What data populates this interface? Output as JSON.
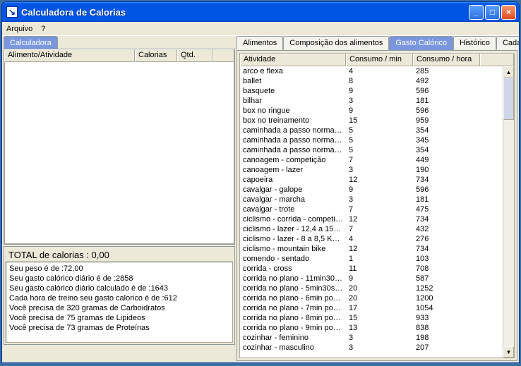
{
  "window": {
    "title": "Calculadora de Calorias"
  },
  "menu": {
    "file": "Arquivo",
    "help": "?"
  },
  "left": {
    "calc_tab": "Calculadora",
    "headers": {
      "alimento": "Alimento/Atividade",
      "calorias": "Calorias",
      "qtd": "Qtd."
    },
    "total_label": "TOTAL de calorias : 0,00",
    "lines": [
      "Seu peso é de :72,00",
      "Seu gasto calórico diário é de :2858",
      "Seu gasto calórico diário calculado é de :1643",
      "Cada hora de treino seu gasto calorico é de :612",
      "Você precisa de 320 gramas de Carboidratos",
      "Você precisa de  75 gramas de Lipideos",
      "Você precisa de  73 gramas de Proteínas"
    ]
  },
  "right": {
    "tabs": [
      "Alimentos",
      "Composição dos alimentos",
      "Gasto Calórico",
      "Histórico",
      "Cadastr"
    ],
    "active_tab": 2,
    "headers": {
      "atividade": "Atividade",
      "cmin": "Consumo / min",
      "chora": "Consumo / hora"
    },
    "rows": [
      {
        "a": "arco e flexa",
        "m": "4",
        "h": "285"
      },
      {
        "a": "ballet",
        "m": "8",
        "h": "492"
      },
      {
        "a": "basquete",
        "m": "9",
        "h": "596"
      },
      {
        "a": "bilhar",
        "m": "3",
        "h": "181"
      },
      {
        "a": "box no ringue",
        "m": "9",
        "h": "596"
      },
      {
        "a": "box no treinamento",
        "m": "15",
        "h": "959"
      },
      {
        "a": "caminhada a passo normal (...",
        "m": "5",
        "h": "354"
      },
      {
        "a": "caminhada a passo normal (...",
        "m": "5",
        "h": "345"
      },
      {
        "a": "caminhada a passo normal (...",
        "m": "5",
        "h": "354"
      },
      {
        "a": "canoagem - competição",
        "m": "7",
        "h": "449"
      },
      {
        "a": "canoagem - lazer",
        "m": "3",
        "h": "190"
      },
      {
        "a": "capoeira",
        "m": "12",
        "h": "734"
      },
      {
        "a": "cavalgar - galope",
        "m": "9",
        "h": "596"
      },
      {
        "a": "cavalgar - marcha",
        "m": "3",
        "h": "181"
      },
      {
        "a": "cavalgar - trote",
        "m": "7",
        "h": "475"
      },
      {
        "a": "ciclismo - corrida - competição",
        "m": "12",
        "h": "734"
      },
      {
        "a": "ciclismo - lazer - 12,4 a 15 K...",
        "m": "7",
        "h": "432"
      },
      {
        "a": "ciclismo - lazer - 8 a 8,5 Km/h",
        "m": "4",
        "h": "276"
      },
      {
        "a": "ciclismo - mountain bike",
        "m": "12",
        "h": "734"
      },
      {
        "a": "comendo - sentado",
        "m": "1",
        "h": "103"
      },
      {
        "a": "corrida - cross",
        "m": "11",
        "h": "708"
      },
      {
        "a": "corrida no plano - 11min30s ...",
        "m": "9",
        "h": "587"
      },
      {
        "a": "corrida no plano - 5min30s p...",
        "m": "20",
        "h": "1252"
      },
      {
        "a": "corrida no plano - 6min por 1...",
        "m": "20",
        "h": "1200"
      },
      {
        "a": "corrida no plano - 7min por 1...",
        "m": "17",
        "h": "1054"
      },
      {
        "a": "corrida no plano - 8min por 1...",
        "m": "15",
        "h": "933"
      },
      {
        "a": "corrida no plano - 9min por 1...",
        "m": "13",
        "h": "838"
      },
      {
        "a": "cozinhar - feminino",
        "m": "3",
        "h": "198"
      },
      {
        "a": "cozinhar - masculino",
        "m": "3",
        "h": "207"
      }
    ]
  }
}
